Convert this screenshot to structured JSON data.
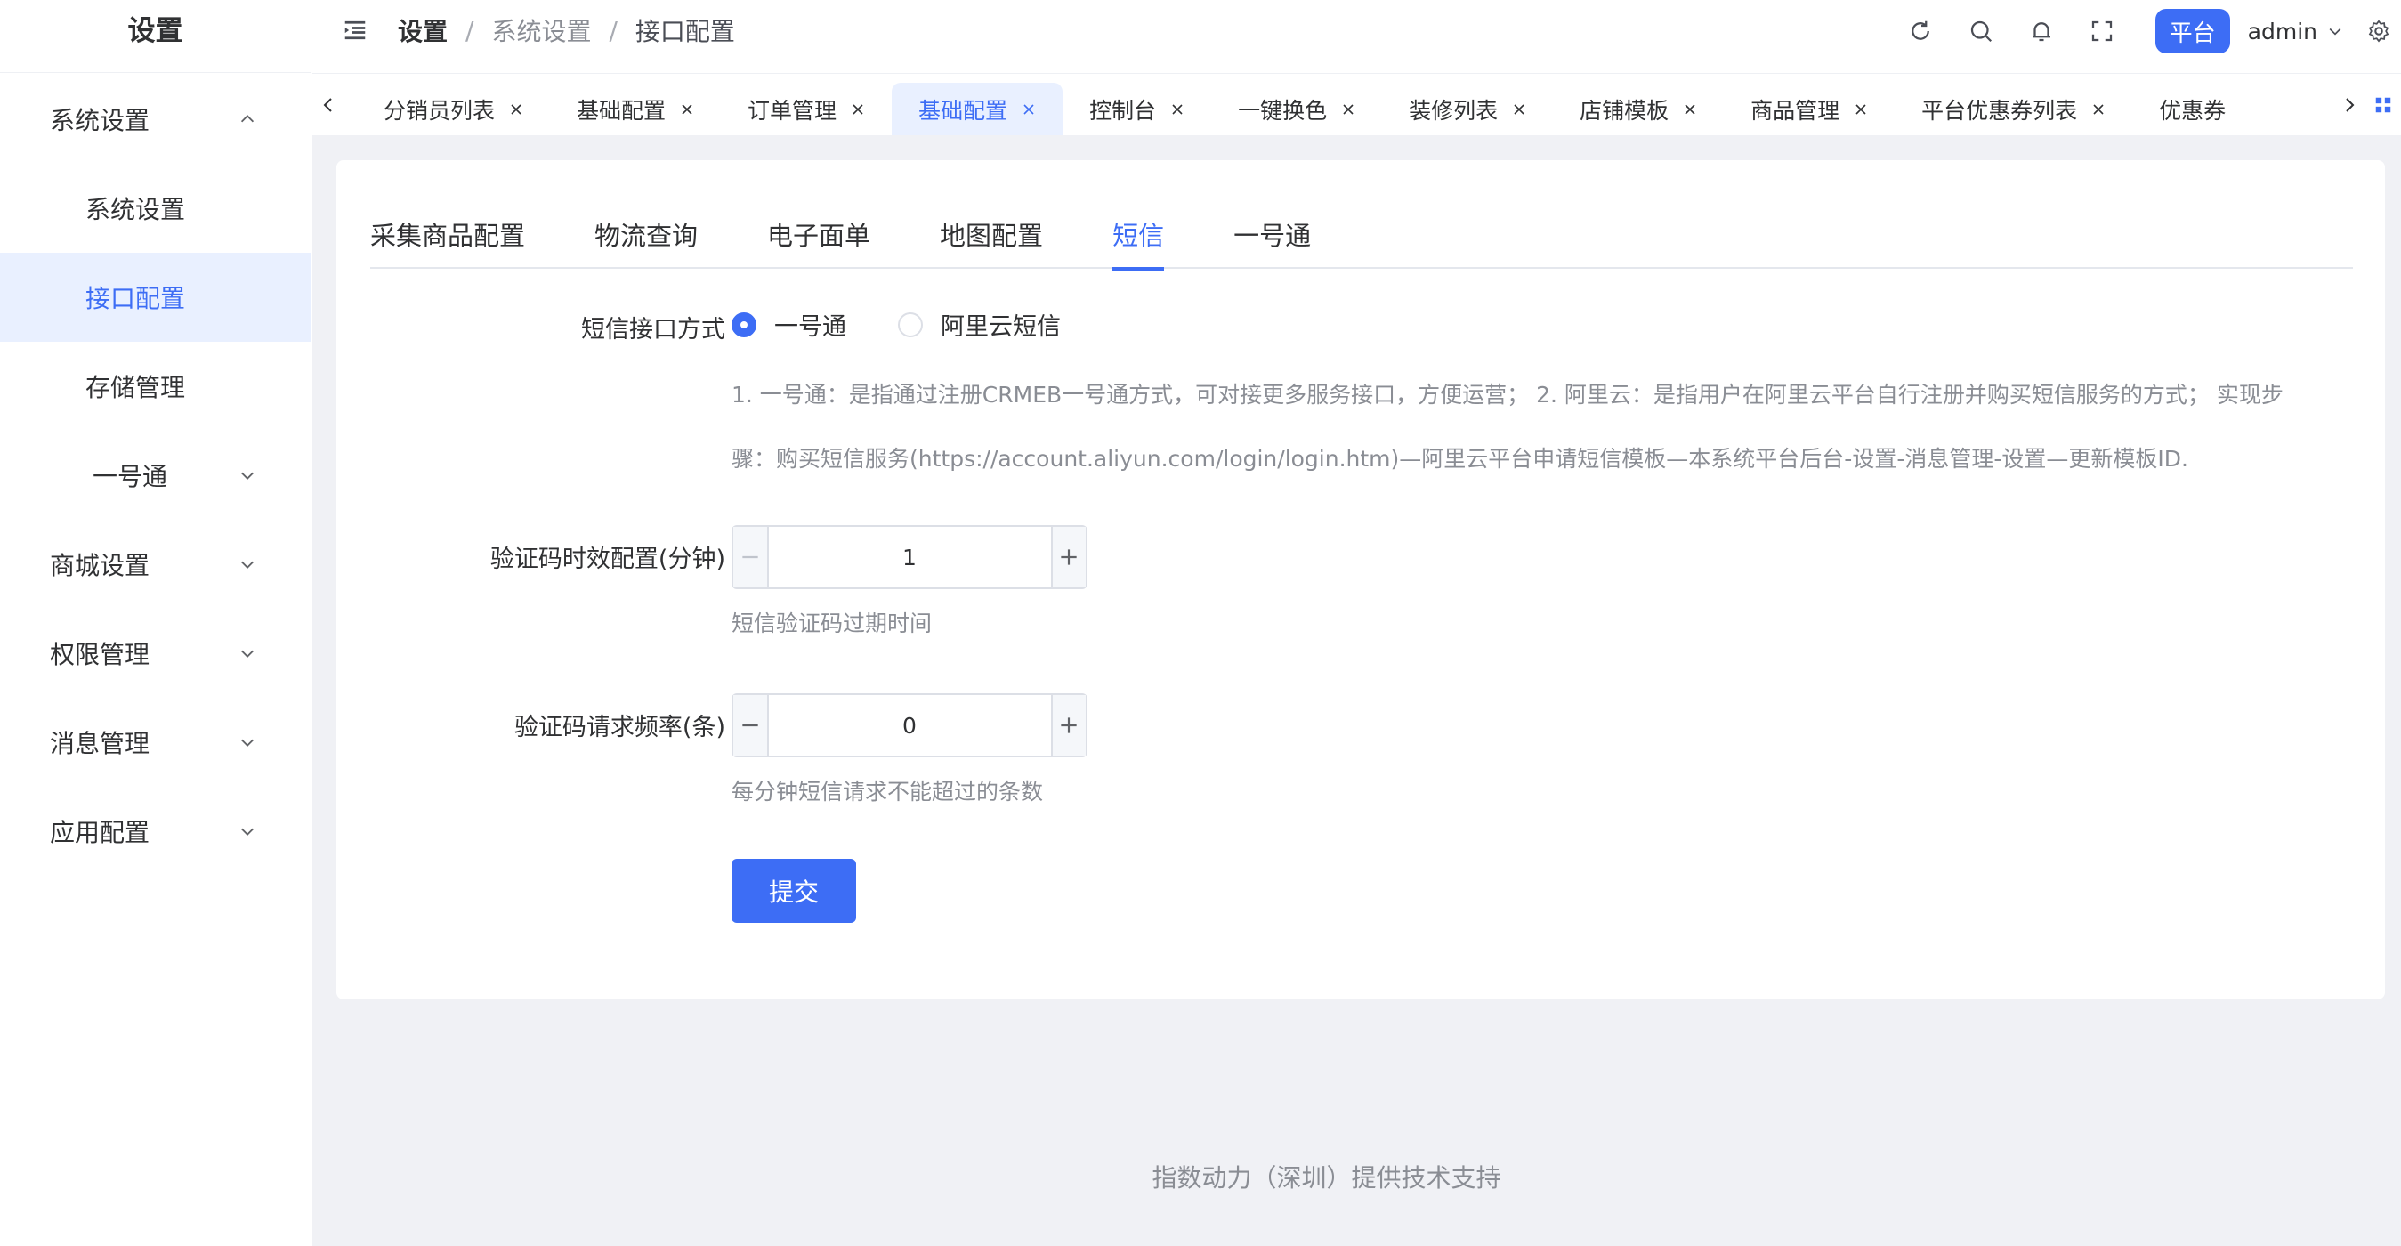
{
  "sidebar": {
    "title": "设置",
    "items": [
      {
        "label": "系统设置",
        "level": "top",
        "arrow": "chevron-up-icon"
      },
      {
        "label": "系统设置",
        "level": "sub"
      },
      {
        "label": "接口配置",
        "level": "sub",
        "active": true
      },
      {
        "label": "存储管理",
        "level": "sub"
      },
      {
        "label": "一号通",
        "level": "sub-group",
        "arrow": "chevron-down-icon"
      },
      {
        "label": "商城设置",
        "level": "top",
        "arrow": "chevron-down-icon"
      },
      {
        "label": "权限管理",
        "level": "top",
        "arrow": "chevron-down-icon"
      },
      {
        "label": "消息管理",
        "level": "top",
        "arrow": "chevron-down-icon"
      },
      {
        "label": "应用配置",
        "level": "top",
        "arrow": "chevron-down-icon"
      }
    ]
  },
  "header": {
    "breadcrumb": [
      "设置",
      "系统设置",
      "接口配置"
    ],
    "separator": "/",
    "icons": [
      "refresh-icon",
      "search-icon",
      "bell-icon",
      "fullscreen-icon"
    ],
    "platform_badge": "平台",
    "user": "admin",
    "settings_icon": "gear-icon"
  },
  "view_tabs": {
    "items": [
      "分销员列表",
      "基础配置",
      "订单管理",
      "基础配置",
      "控制台",
      "一键换色",
      "装修列表",
      "店铺模板",
      "商品管理",
      "平台优惠券列表",
      "优惠券"
    ],
    "active_index": 3
  },
  "content_tabs": {
    "items": [
      "采集商品配置",
      "物流查询",
      "电子面单",
      "地图配置",
      "短信",
      "一号通"
    ],
    "active_index": 4
  },
  "form": {
    "sms_method": {
      "label": "短信接口方式",
      "options": [
        "一号通",
        "阿里云短信"
      ],
      "selected": "一号通",
      "description_line1": "1. 一号通：是指通过注册CRMEB一号通方式，可对接更多服务接口，方便运营； 2. 阿里云：是指用户在阿里云平台自行注册并购买短信服务的方式； 实现步",
      "description_line2": "骤：购买短信服务(https://account.aliyun.com/login/login.htm)—阿里云平台申请短信模板—本系统平台后台-设置-消息管理-设置—更新模板ID."
    },
    "code_expire": {
      "label": "验证码时效配置(分钟)",
      "value": "1",
      "hint": "短信验证码过期时间"
    },
    "request_rate": {
      "label": "验证码请求频率(条)",
      "value": "0",
      "hint": "每分钟短信请求不能超过的条数"
    },
    "submit_label": "提交"
  },
  "footer": "指数动力（深圳）提供技术支持",
  "colors": {
    "accent": "#3d6df5",
    "active_bg": "#e9f0ff",
    "main_bg": "#f0f1f5",
    "muted_text": "#8a8d94"
  }
}
